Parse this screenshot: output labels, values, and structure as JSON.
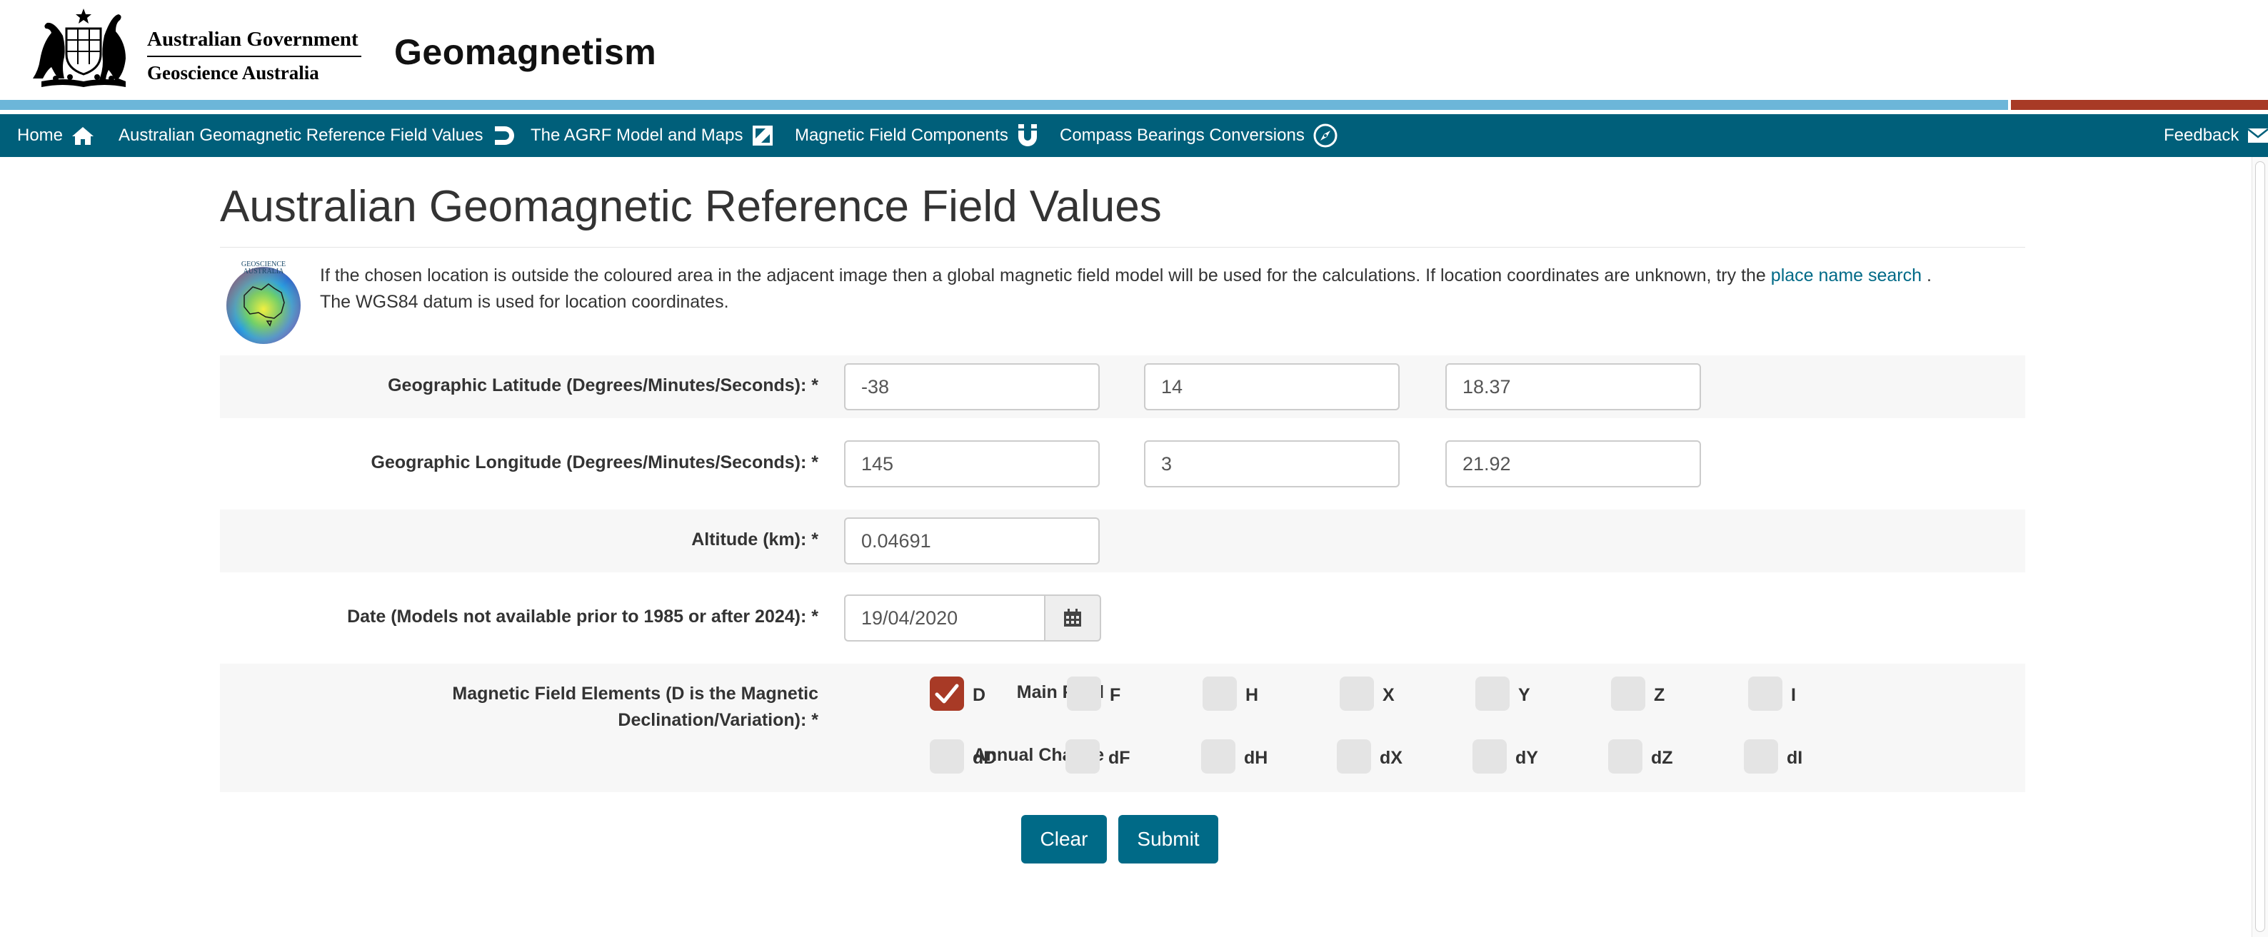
{
  "header": {
    "govt_line1": "Australian Government",
    "govt_line2": "Geoscience Australia",
    "site_title": "Geomagnetism"
  },
  "nav": {
    "items": [
      {
        "label": "Home",
        "icon": "home-icon"
      },
      {
        "label": "Australian Geomagnetic Reference Field Values",
        "icon": "magnet-icon"
      },
      {
        "label": "The AGRF Model and Maps",
        "icon": "map-icon"
      },
      {
        "label": "Magnetic Field Components",
        "icon": "magnet-u-icon"
      },
      {
        "label": "Compass Bearings Conversions",
        "icon": "compass-icon"
      }
    ],
    "feedback": {
      "label": "Feedback",
      "icon": "envelope-icon"
    }
  },
  "page": {
    "title": "Australian Geomagnetic Reference Field Values",
    "globe_text_1": "GEOSCIENCE",
    "globe_text_2": "AUSTRALIA",
    "intro_text": "If the chosen location is outside the coloured area in the adjacent image then a global magnetic field model will be used for the calculations. If location coordinates are unknown, try the",
    "intro_link": "place name search",
    "intro_after": ".",
    "intro_text_2": "The WGS84 datum is used for location coordinates."
  },
  "form": {
    "latitude": {
      "label": "Geographic Latitude (Degrees/Minutes/Seconds): *",
      "degrees": "-38",
      "minutes": "14",
      "seconds": "18.37"
    },
    "longitude": {
      "label": "Geographic Longitude (Degrees/Minutes/Seconds): *",
      "degrees": "145",
      "minutes": "3",
      "seconds": "21.92"
    },
    "altitude": {
      "label": "Altitude (km): *",
      "value": "0.04691"
    },
    "date": {
      "label": "Date (Models not available prior to 1985 or after 2024): *",
      "value": "19/04/2020",
      "icon": "calendar-icon"
    },
    "elements": {
      "label_line1": "Magnetic Field Elements (D is the Magnetic",
      "label_line2": "Declination/Variation): *",
      "main_field_label": "Main Field",
      "annual_change_label": "Annual Change",
      "main_field": [
        {
          "name": "D",
          "checked": true
        },
        {
          "name": "F",
          "checked": false
        },
        {
          "name": "H",
          "checked": false
        },
        {
          "name": "X",
          "checked": false
        },
        {
          "name": "Y",
          "checked": false
        },
        {
          "name": "Z",
          "checked": false
        },
        {
          "name": "I",
          "checked": false
        }
      ],
      "annual_change": [
        {
          "name": "dD",
          "checked": false
        },
        {
          "name": "dF",
          "checked": false
        },
        {
          "name": "dH",
          "checked": false
        },
        {
          "name": "dX",
          "checked": false
        },
        {
          "name": "dY",
          "checked": false
        },
        {
          "name": "dZ",
          "checked": false
        },
        {
          "name": "dI",
          "checked": false
        }
      ]
    },
    "buttons": {
      "clear": "Clear",
      "submit": "Submit"
    }
  },
  "colors": {
    "nav_bg": "#005f7a",
    "stripe_blue": "#6cb6d9",
    "stripe_red": "#a83a26",
    "button": "#006a87",
    "checked": "#a83a26",
    "link": "#006a87"
  }
}
